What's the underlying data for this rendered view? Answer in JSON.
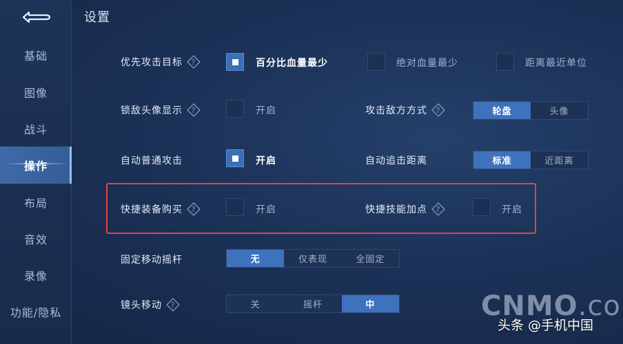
{
  "page": {
    "title": "设置"
  },
  "sidebar": {
    "items": [
      {
        "label": "基础",
        "active": false
      },
      {
        "label": "图像",
        "active": false
      },
      {
        "label": "战斗",
        "active": false
      },
      {
        "label": "操作",
        "active": true
      },
      {
        "label": "布局",
        "active": false
      },
      {
        "label": "音效",
        "active": false
      },
      {
        "label": "录像",
        "active": false
      },
      {
        "label": "功能/隐私",
        "active": false
      }
    ]
  },
  "settings": {
    "priority_target": {
      "label": "优先攻击目标",
      "options": [
        {
          "label": "百分比血量最少",
          "checked": true
        },
        {
          "label": "绝对血量最少",
          "checked": false
        },
        {
          "label": "距离最近单位",
          "checked": false
        }
      ]
    },
    "lock_portrait": {
      "label": "锁敌头像显示",
      "option_label": "开启",
      "checked": false
    },
    "attack_mode": {
      "label": "攻击敌方方式",
      "options": [
        "轮盘",
        "头像"
      ],
      "selected": "轮盘"
    },
    "auto_attack": {
      "label": "自动普通攻击",
      "option_label": "开启",
      "checked": true
    },
    "auto_chase": {
      "label": "自动追击距离",
      "options": [
        "标准",
        "近距离"
      ],
      "selected": "标准"
    },
    "quick_buy": {
      "label": "快捷装备购买",
      "option_label": "开启",
      "checked": false
    },
    "quick_skill": {
      "label": "快捷技能加点",
      "option_label": "开启",
      "checked": false
    },
    "fixed_joystick": {
      "label": "固定移动摇杆",
      "options": [
        "无",
        "仅表现",
        "全固定"
      ],
      "selected": "无"
    },
    "camera_move": {
      "label": "镜头移动",
      "options": [
        "关",
        "摇杆",
        "中"
      ],
      "selected": "中"
    }
  },
  "watermark": {
    "cnmo_bold": "CNMO",
    "cnmo_thin": ".com",
    "toutiao": "头条 @手机中国"
  },
  "colors": {
    "accent": "#3f72bd",
    "highlight": "#e0473f",
    "background": "#1b3157"
  }
}
